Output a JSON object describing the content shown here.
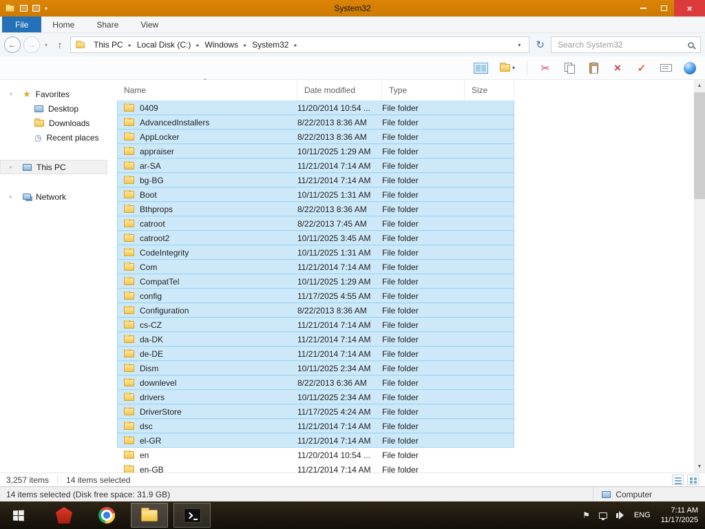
{
  "titlebar": {
    "title": "System32"
  },
  "ribbon": {
    "tabs": [
      {
        "label": "File",
        "accent": true
      },
      {
        "label": "Home",
        "accent": false
      },
      {
        "label": "Share",
        "accent": false
      },
      {
        "label": "View",
        "accent": false
      }
    ]
  },
  "address": {
    "segments": [
      "This PC",
      "Local Disk (C:)",
      "Windows",
      "System32"
    ],
    "search_placeholder": "Search System32"
  },
  "sidebar": {
    "sections": [
      {
        "label": "Favorites",
        "icon": "favorites-star",
        "expanded": true,
        "highlight": false,
        "children": [
          {
            "label": "Desktop",
            "icon": "desktop-monitor"
          },
          {
            "label": "Downloads",
            "icon": "downloads-folder"
          },
          {
            "label": "Recent places",
            "icon": "recent-places-clock"
          }
        ]
      },
      {
        "label": "This PC",
        "icon": "computer-monitor",
        "expanded": false,
        "highlight": true,
        "children": []
      },
      {
        "label": "Network",
        "icon": "network-monitors",
        "expanded": false,
        "highlight": false,
        "children": []
      }
    ]
  },
  "filelist": {
    "columns": [
      "Name",
      "Date modified",
      "Type",
      "Size"
    ],
    "rows": [
      {
        "name": "0409",
        "date": "11/20/2014 10:54 ...",
        "type": "File folder",
        "size": "",
        "selected": true
      },
      {
        "name": "AdvancedInstallers",
        "date": "8/22/2013 8:36 AM",
        "type": "File folder",
        "size": "",
        "selected": true
      },
      {
        "name": "AppLocker",
        "date": "8/22/2013 8:36 AM",
        "type": "File folder",
        "size": "",
        "selected": true
      },
      {
        "name": "appraiser",
        "date": "10/11/2025 1:29 AM",
        "type": "File folder",
        "size": "",
        "selected": true
      },
      {
        "name": "ar-SA",
        "date": "11/21/2014 7:14 AM",
        "type": "File folder",
        "size": "",
        "selected": true
      },
      {
        "name": "bg-BG",
        "date": "11/21/2014 7:14 AM",
        "type": "File folder",
        "size": "",
        "selected": true
      },
      {
        "name": "Boot",
        "date": "10/11/2025 1:31 AM",
        "type": "File folder",
        "size": "",
        "selected": true
      },
      {
        "name": "Bthprops",
        "date": "8/22/2013 8:36 AM",
        "type": "File folder",
        "size": "",
        "selected": true
      },
      {
        "name": "catroot",
        "date": "8/22/2013 7:45 AM",
        "type": "File folder",
        "size": "",
        "selected": true
      },
      {
        "name": "catroot2",
        "date": "10/11/2025 3:45 AM",
        "type": "File folder",
        "size": "",
        "selected": true
      },
      {
        "name": "CodeIntegrity",
        "date": "10/11/2025 1:31 AM",
        "type": "File folder",
        "size": "",
        "selected": true
      },
      {
        "name": "Com",
        "date": "11/21/2014 7:14 AM",
        "type": "File folder",
        "size": "",
        "selected": true
      },
      {
        "name": "CompatTel",
        "date": "10/11/2025 1:29 AM",
        "type": "File folder",
        "size": "",
        "selected": true
      },
      {
        "name": "config",
        "date": "11/17/2025 4:55 AM",
        "type": "File folder",
        "size": "",
        "selected": true
      },
      {
        "name": "Configuration",
        "date": "8/22/2013 8:36 AM",
        "type": "File folder",
        "size": "",
        "selected": true
      },
      {
        "name": "cs-CZ",
        "date": "11/21/2014 7:14 AM",
        "type": "File folder",
        "size": "",
        "selected": true
      },
      {
        "name": "da-DK",
        "date": "11/21/2014 7:14 AM",
        "type": "File folder",
        "size": "",
        "selected": true
      },
      {
        "name": "de-DE",
        "date": "11/21/2014 7:14 AM",
        "type": "File folder",
        "size": "",
        "selected": true
      },
      {
        "name": "Dism",
        "date": "10/11/2025 2:34 AM",
        "type": "File folder",
        "size": "",
        "selected": true
      },
      {
        "name": "downlevel",
        "date": "8/22/2013 6:36 AM",
        "type": "File folder",
        "size": "",
        "selected": true
      },
      {
        "name": "drivers",
        "date": "10/11/2025 2:34 AM",
        "type": "File folder",
        "size": "",
        "selected": true
      },
      {
        "name": "DriverStore",
        "date": "11/17/2025 4:24 AM",
        "type": "File folder",
        "size": "",
        "selected": true
      },
      {
        "name": "dsc",
        "date": "11/21/2014 7:14 AM",
        "type": "File folder",
        "size": "",
        "selected": true
      },
      {
        "name": "el-GR",
        "date": "11/21/2014 7:14 AM",
        "type": "File folder",
        "size": "",
        "selected": true
      },
      {
        "name": "en",
        "date": "11/20/2014 10:54 ...",
        "type": "File folder",
        "size": "",
        "selected": false
      },
      {
        "name": "en-GB",
        "date": "11/21/2014 7:14 AM",
        "type": "File folder",
        "size": "",
        "selected": false
      }
    ]
  },
  "statusbar": {
    "items_count": "3,257 items",
    "selected_count": "14 items selected"
  },
  "classic_statusbar": {
    "text": "14 items selected (Disk free space: 31.9 GB)",
    "computer_label": "Computer"
  },
  "taskbar": {
    "language": "ENG",
    "time": "7:11 AM",
    "date": "11/17/2025"
  }
}
